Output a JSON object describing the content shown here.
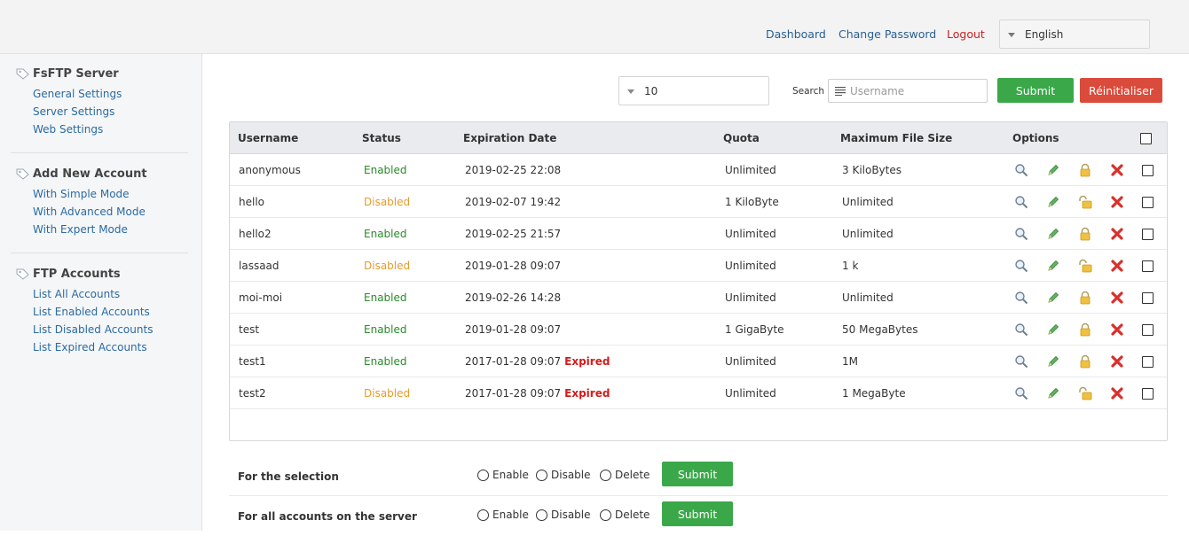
{
  "topnav": {
    "dashboard": "Dashboard",
    "change_password": "Change Password",
    "logout": "Logout",
    "language": "English"
  },
  "sidebar": {
    "sections": [
      {
        "title": "FsFTP Server",
        "links": [
          "General Settings",
          "Server Settings",
          "Web Settings"
        ]
      },
      {
        "title": "Add New Account",
        "links": [
          "With Simple Mode",
          "With Advanced Mode",
          "With Expert Mode"
        ]
      },
      {
        "title": "FTP Accounts",
        "links": [
          "List All Accounts",
          "List Enabled Accounts",
          "List Disabled Accounts",
          "List Expired Accounts"
        ]
      }
    ]
  },
  "toolbar": {
    "per_page": "10",
    "search_label": "Search",
    "search_placeholder": "Username",
    "submit_label": "Submit",
    "reset_label": "Réinitialiser"
  },
  "table": {
    "headers": {
      "username": "Username",
      "status": "Status",
      "expiration": "Expiration Date",
      "quota": "Quota",
      "max_file_size": "Maximum File Size",
      "options": "Options"
    },
    "rows": [
      {
        "username": "anonymous",
        "status": "Enabled",
        "status_type": "enabled",
        "expiration": "2019-02-25 22:08",
        "expired": "",
        "quota": "Unlimited",
        "max_file_size": "3 KiloBytes",
        "locked": true
      },
      {
        "username": "hello",
        "status": "Disabled",
        "status_type": "disabled",
        "expiration": "2019-02-07 19:42",
        "expired": "",
        "quota": "1 KiloByte",
        "max_file_size": "Unlimited",
        "locked": false
      },
      {
        "username": "hello2",
        "status": "Enabled",
        "status_type": "enabled",
        "expiration": "2019-02-25 21:57",
        "expired": "",
        "quota": "Unlimited",
        "max_file_size": "Unlimited",
        "locked": true
      },
      {
        "username": "lassaad",
        "status": "Disabled",
        "status_type": "disabled",
        "expiration": "2019-01-28 09:07",
        "expired": "",
        "quota": "Unlimited",
        "max_file_size": "1 k",
        "locked": false
      },
      {
        "username": "moi-moi",
        "status": "Enabled",
        "status_type": "enabled",
        "expiration": "2019-02-26 14:28",
        "expired": "",
        "quota": "Unlimited",
        "max_file_size": "Unlimited",
        "locked": true
      },
      {
        "username": "test",
        "status": "Enabled",
        "status_type": "enabled",
        "expiration": "2019-01-28 09:07",
        "expired": "",
        "quota": "1 GigaByte",
        "max_file_size": "50 MegaBytes",
        "locked": true
      },
      {
        "username": "test1",
        "status": "Enabled",
        "status_type": "enabled",
        "expiration": "2017-01-28 09:07",
        "expired": "Expired",
        "quota": "Unlimited",
        "max_file_size": "1M",
        "locked": true
      },
      {
        "username": "test2",
        "status": "Disabled",
        "status_type": "disabled",
        "expiration": "2017-01-28 09:07",
        "expired": "Expired",
        "quota": "Unlimited",
        "max_file_size": "1 MegaByte",
        "locked": false
      }
    ]
  },
  "bulk": {
    "rows": [
      {
        "label": "For the selection",
        "enable": "Enable",
        "disable": "Disable",
        "delete": "Delete",
        "submit": "Submit"
      },
      {
        "label": "For all accounts on the server",
        "enable": "Enable",
        "disable": "Disable",
        "delete": "Delete",
        "submit": "Submit"
      }
    ]
  },
  "colors": {
    "enabled": "#2a8a2a",
    "disabled": "#e79b2b",
    "expired": "#d01c1c",
    "submit": "#3aa849",
    "reset": "#da4b3b",
    "link": "#2a6aa3"
  }
}
